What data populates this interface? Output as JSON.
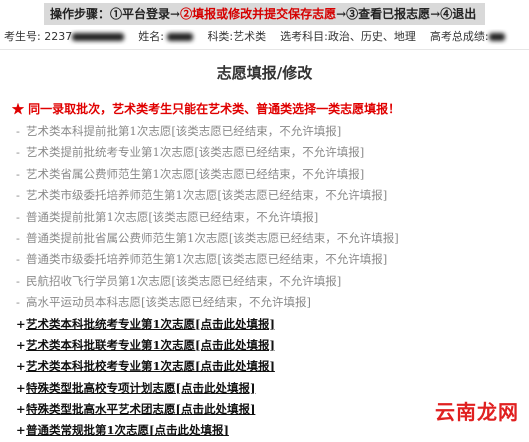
{
  "steps": {
    "label": "操作步骤：",
    "items": [
      {
        "text": "①平台登录",
        "active": false
      },
      {
        "text": "②填报或修改并提交保存志愿",
        "active": true
      },
      {
        "text": "③查看已报志愿",
        "active": false
      },
      {
        "text": "④退出",
        "active": false
      }
    ],
    "arrow": "→"
  },
  "info": {
    "exam_no_label": "考生号:",
    "exam_no_visible": "2237",
    "name_label": "姓名:",
    "subject_label": "科类:",
    "subject_value": "艺术类",
    "elective_label": "选考科目:",
    "elective_value": "政治、历史、地理",
    "total_label": "高考总成绩:"
  },
  "page_title": "志愿填报/修改",
  "notice": "★ 同一录取批次，艺术类考生只能在艺术类、普通类选择一类志愿填报！",
  "closed_items": [
    "艺术类本科提前批第1次志愿[该类志愿已经结束，不允许填报]",
    "艺术类提前批统考专业第1次志愿[该类志愿已经结束，不允许填报]",
    "艺术类省属公费师范生第1次志愿[该类志愿已经结束，不允许填报]",
    "艺术类市级委托培养师范生第1次志愿[该类志愿已经结束，不允许填报]",
    "普通类提前批第1次志愿[该类志愿已经结束，不允许填报]",
    "普通类提前批省属公费师范生第1次志愿[该类志愿已经结束，不允许填报]",
    "普通类市级委托培养师范生第1次志愿[该类志愿已经结束，不允许填报]",
    "民航招收飞行学员第1次志愿[该类志愿已经结束，不允许填报]",
    "高水平运动员本科志愿[该类志愿已经结束，不允许填报]"
  ],
  "closed_marker": "-",
  "open_items": [
    "艺术类本科批统考专业第1次志愿[点击此处填报]",
    "艺术类本科批联考专业第1次志愿[点击此处填报]",
    "艺术类本科批校考专业第1次志愿[点击此处填报]",
    "特殊类型批高校专项计划志愿[点击此处填报]",
    "特殊类型批高水平艺术团志愿[点击此处填报]",
    "普通类常规批第1次志愿[点击此处填报]"
  ],
  "open_marker": "+",
  "watermark": "云南龙网"
}
